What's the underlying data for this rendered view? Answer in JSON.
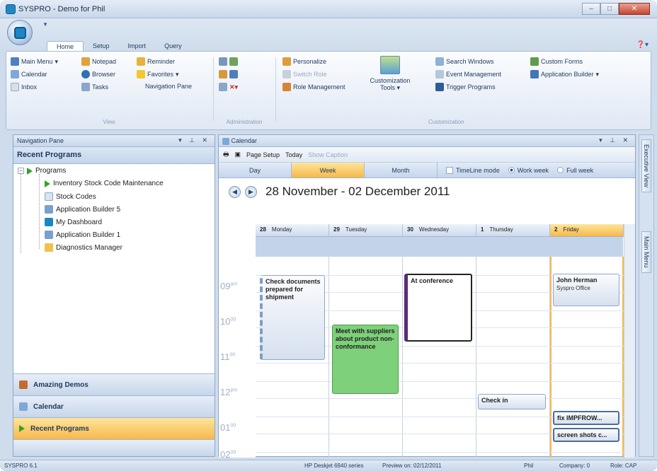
{
  "window": {
    "title": "SYSPRO - Demo for Phil"
  },
  "ribbon": {
    "tabs": [
      "Home",
      "Setup",
      "Import",
      "Query"
    ],
    "view_group": {
      "label": "View",
      "items": [
        "Main Menu",
        "Calendar",
        "Inbox",
        "Notepad",
        "Browser",
        "Tasks",
        "Reminder",
        "Favorites",
        "Navigation Pane"
      ]
    },
    "admin_group": {
      "label": "Administration"
    },
    "custom_group": {
      "label": "Customization",
      "items": [
        "Personalize",
        "Switch Role",
        "Role Management",
        "Search Windows",
        "Event Management",
        "Trigger Programs",
        "Custom Forms",
        "Application Builder"
      ],
      "big_label": "Customization Tools"
    }
  },
  "nav_pane": {
    "header": "Navigation Pane",
    "title": "Recent Programs",
    "tree_root": "Programs",
    "items": [
      "Inventory Stock Code Maintenance",
      "Stock Codes",
      "Application Builder 5",
      "My Dashboard",
      "Application Builder 1",
      "Diagnostics Manager"
    ],
    "bars": [
      "Amazing Demos",
      "Calendar",
      "Recent Programs"
    ]
  },
  "calendar": {
    "header": "Calendar",
    "toolbar": {
      "page_setup": "Page Setup",
      "today": "Today",
      "show_caption": "Show Caption"
    },
    "views": [
      "Day",
      "Week",
      "Month"
    ],
    "options": [
      "TimeLine mode",
      "Work week",
      "Full week"
    ],
    "date_range": "28 November - 02 December 2011",
    "days": [
      {
        "num": "28",
        "name": "Monday"
      },
      {
        "num": "29",
        "name": "Tuesday"
      },
      {
        "num": "30",
        "name": "Wednesday"
      },
      {
        "num": "1",
        "name": "Thursday"
      },
      {
        "num": "2",
        "name": "Friday"
      }
    ],
    "times": [
      {
        "h": "09",
        "m": "am"
      },
      {
        "h": "10",
        "m": "00"
      },
      {
        "h": "11",
        "m": "00"
      },
      {
        "h": "12",
        "m": "pm"
      },
      {
        "h": "01",
        "m": "00"
      },
      {
        "h": "02",
        "m": "00"
      }
    ],
    "appointments": [
      {
        "title": "Check documents prepared for shipment"
      },
      {
        "title": "Meet with suppliers about product non-conformance"
      },
      {
        "title": "At conference"
      },
      {
        "title": "Check in"
      },
      {
        "title": "John Herman",
        "sub": "Syspro Office"
      },
      {
        "title": "fix IMPFROW..."
      },
      {
        "title": "screen shots c..."
      }
    ]
  },
  "side_tabs": [
    "Executive View",
    "Main Menu"
  ],
  "status": {
    "version": "SYSPRO 6.1",
    "printer": "HP Deskjet 6940 series",
    "preview": "Preview on: 02/12/2011",
    "user": "Phil",
    "company": "Company: 0",
    "role": "Role: CAP"
  }
}
